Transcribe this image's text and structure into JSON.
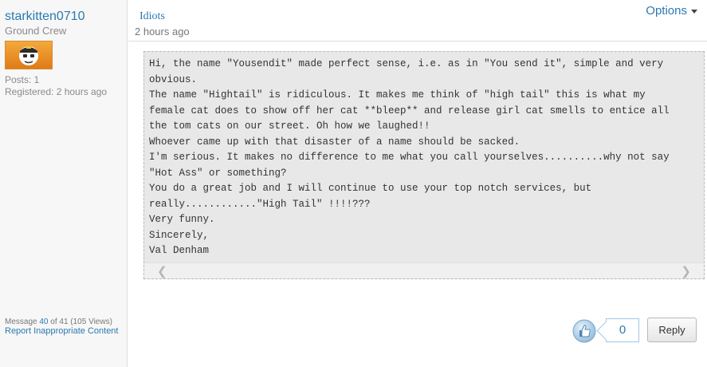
{
  "author": {
    "username": "starkitten0710",
    "rank": "Ground Crew",
    "posts": "Posts: 1",
    "registered": "Registered: 2 hours ago"
  },
  "post": {
    "subject": "Idiots",
    "time": "2 hours ago",
    "options_label": "Options",
    "body_lines": [
      "Hi, the name \"Yousendit\" made perfect sense, i.e. as in \"You send it\", simple and very",
      "obvious.",
      "The name \"Hightail\" is ridiculous. It makes me think of \"high tail\" this is what my",
      "female cat does to show off her cat **bleep** and release girl cat smells to entice all",
      "the tom cats on our street. Oh how we laughed!!",
      "Whoever came up with that disaster of a name should be sacked.",
      "I'm serious. It makes no difference to me what you call yourselves..........why not say",
      "\"Hot Ass\" or something?",
      "You do a great job and I will continue to use your top notch services, but",
      "really............\"High Tail\" !!!!???",
      "Very funny.",
      "Sincerely,",
      "Val Denham"
    ]
  },
  "footer": {
    "message_prefix": "Message ",
    "message_num": "40",
    "message_suffix": " of 41 (105 Views)",
    "report": "Report Inappropriate Content",
    "kudos_count": "0",
    "reply": "Reply"
  },
  "icons": {
    "kudos": "thumbs-up-icon",
    "options": "chevron-down-icon",
    "scroll_left": "chevron-left-icon",
    "scroll_right": "chevron-right-icon"
  },
  "colors": {
    "link": "#2a7ab0",
    "avatar": "#e98b21"
  }
}
